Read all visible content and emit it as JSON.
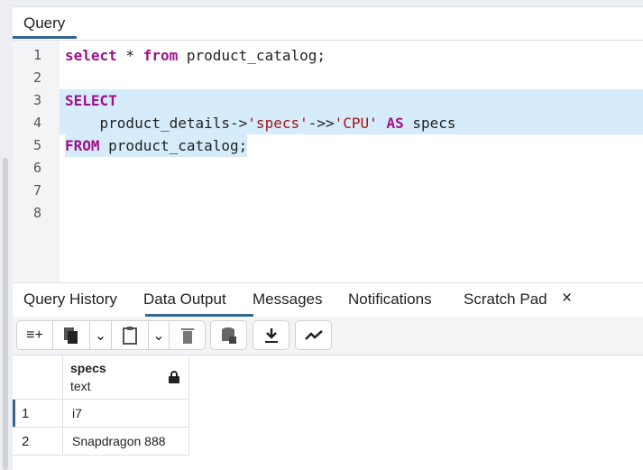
{
  "query_tab": {
    "label": "Query"
  },
  "editor": {
    "lines": [
      {
        "n": "1",
        "parts": [
          {
            "t": "select",
            "c": "kw"
          },
          {
            "t": " * ",
            "c": ""
          },
          {
            "t": "from",
            "c": "kw"
          },
          {
            "t": " product_catalog;",
            "c": ""
          }
        ]
      },
      {
        "n": "2",
        "parts": []
      },
      {
        "n": "3",
        "parts": [
          {
            "t": "SELECT",
            "c": "kw"
          }
        ]
      },
      {
        "n": "4",
        "parts": [
          {
            "t": "    product_details->",
            "c": ""
          },
          {
            "t": "'specs'",
            "c": "str"
          },
          {
            "t": "->>",
            "c": ""
          },
          {
            "t": "'CPU'",
            "c": "str"
          },
          {
            "t": " ",
            "c": ""
          },
          {
            "t": "AS",
            "c": "kw"
          },
          {
            "t": " specs",
            "c": ""
          }
        ]
      },
      {
        "n": "5",
        "parts": [
          {
            "t": "FROM",
            "c": "kw"
          },
          {
            "t": " product_catalog;",
            "c": ""
          }
        ]
      },
      {
        "n": "6",
        "parts": []
      },
      {
        "n": "7",
        "parts": []
      },
      {
        "n": "8",
        "parts": []
      }
    ]
  },
  "bottom_tabs": {
    "query_history": "Query History",
    "data_output": "Data Output",
    "messages": "Messages",
    "notifications": "Notifications",
    "scratch_pad": "Scratch Pad",
    "close": "×"
  },
  "grid": {
    "column": {
      "name": "specs",
      "type": "text"
    },
    "rows": [
      {
        "n": "1",
        "v": "i7"
      },
      {
        "n": "2",
        "v": "Snapdragon 888"
      }
    ]
  },
  "colors": {
    "accent": "#326690",
    "keyword": "#a0108f",
    "string": "#a31515",
    "selection": "#d6ecfa"
  }
}
